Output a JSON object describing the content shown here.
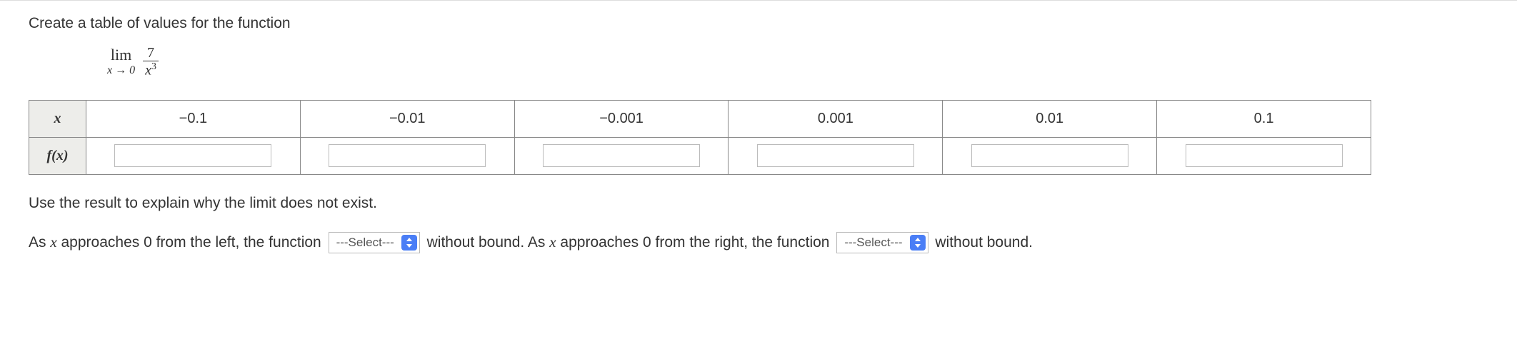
{
  "instruction": "Create a table of values for the function",
  "limit": {
    "lim_text": "lim",
    "approach": "x → 0",
    "numerator": "7",
    "denominator_base": "x",
    "denominator_exp": "3"
  },
  "table": {
    "row1_header": "x",
    "row2_header": "f(x)",
    "x_values": [
      "−0.1",
      "−0.01",
      "−0.001",
      "0.001",
      "0.01",
      "0.1"
    ],
    "fx_values": [
      "",
      "",
      "",
      "",
      "",
      ""
    ]
  },
  "explain": "Use the result to explain why the limit does not exist.",
  "sentence": {
    "part1_a": "As ",
    "part1_var": "x",
    "part1_b": " approaches 0 from the left, the function ",
    "select_placeholder": "---Select---",
    "part2": " without bound. As ",
    "part2_var": "x",
    "part3": " approaches 0 from the right, the function ",
    "part4": " without bound."
  }
}
